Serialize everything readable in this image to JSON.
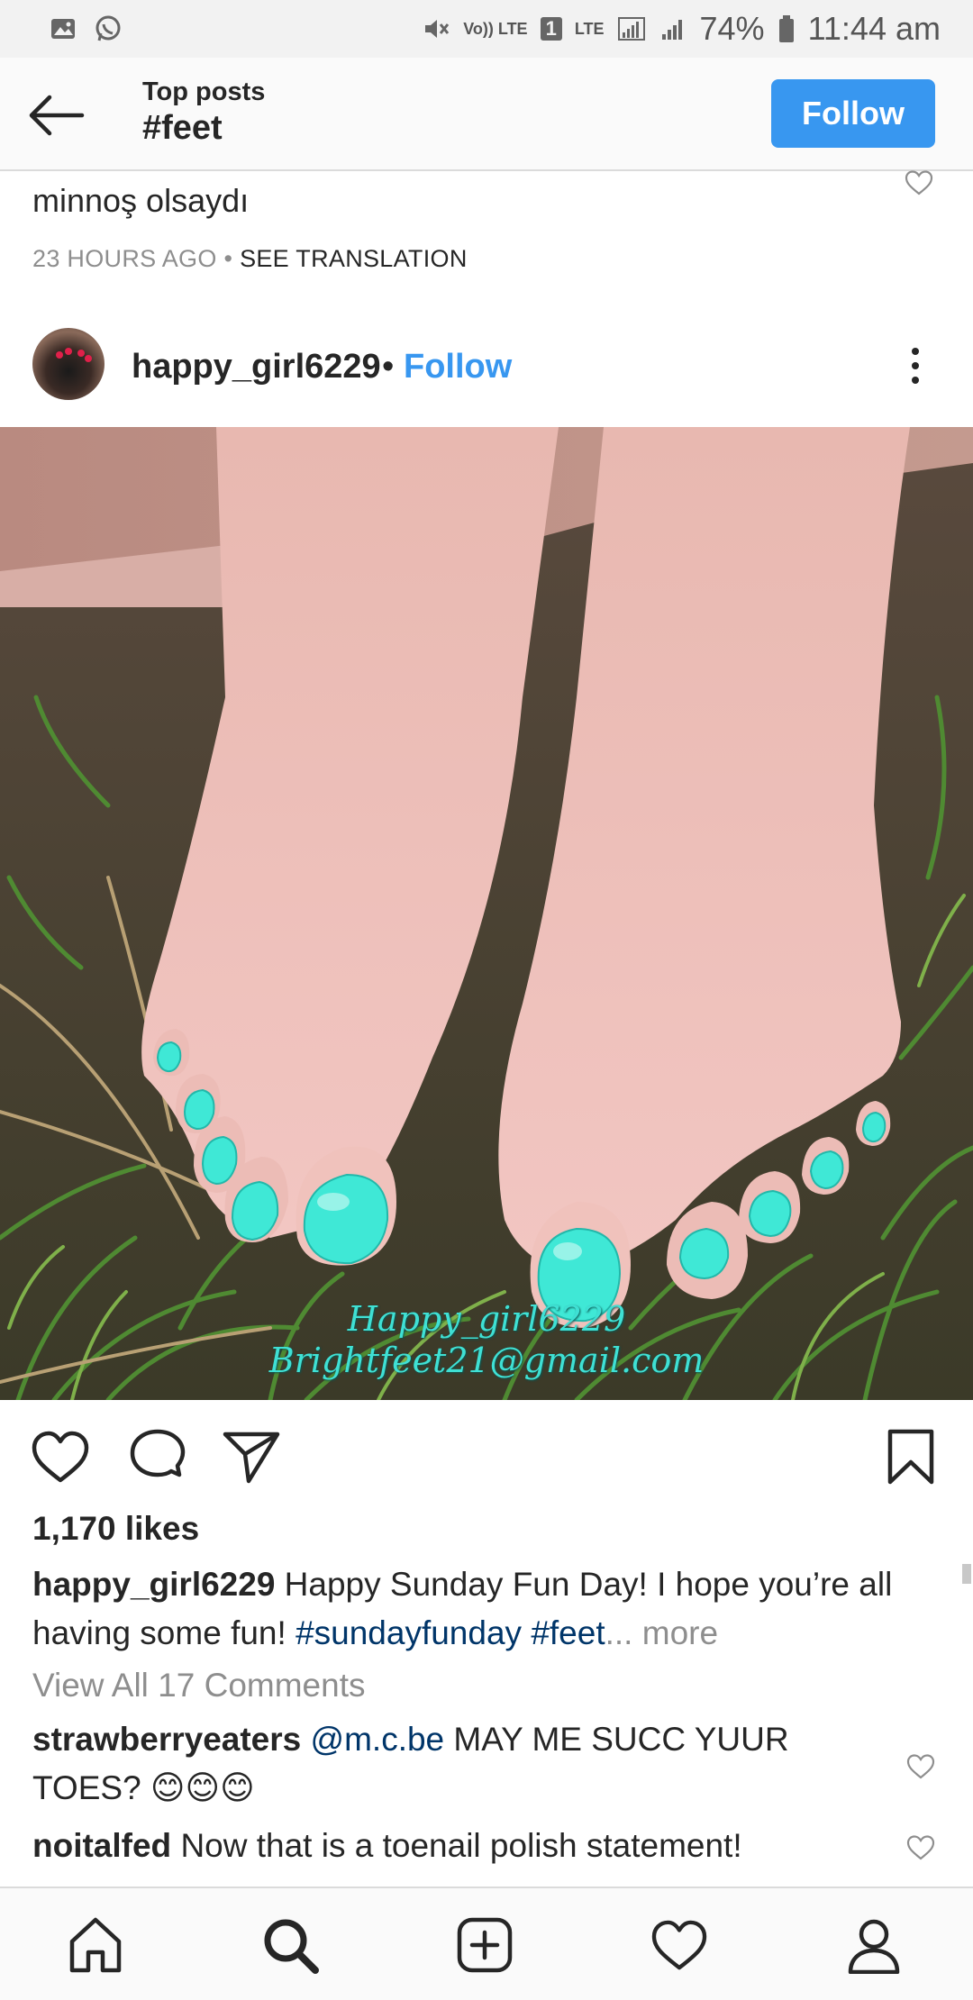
{
  "status_bar": {
    "battery": "74%",
    "time": "11:44 am",
    "volte": "Vo)) LTE",
    "sim": "1",
    "lte": "LTE"
  },
  "header": {
    "subtitle": "Top posts",
    "hashtag": "#feet",
    "follow_label": "Follow"
  },
  "previous_post": {
    "caption_tail": "minnoş olsaydı",
    "time_ago": "23 HOURS AGO",
    "separator": "•",
    "see_translation": "SEE TRANSLATION"
  },
  "post": {
    "username": "happy_girl6229",
    "separator": "•",
    "follow_label": "Follow",
    "watermark_line1": "Happy_girl6229",
    "watermark_line2": "Brightfeet21@gmail.com",
    "likes": "1,170 likes",
    "caption_user": "happy_girl6229",
    "caption_text": " Happy Sunday Fun Day! I hope you’re all having some fun! ",
    "caption_tag1": "#sundayfunday",
    "caption_tag2": " #feet",
    "caption_ellipsis": "...",
    "caption_more": " more",
    "view_all": "View All 17 Comments",
    "comments": [
      {
        "user": "strawberryeaters",
        "mention": " @m.c.be",
        "text": " MAY ME SUCC YUUR TOES? 😊😊😊"
      },
      {
        "user": "noitalfed",
        "mention": "",
        "text": " Now that is a toenail polish statement!"
      }
    ]
  },
  "icons": {
    "back": "arrow-left-icon",
    "heart": "heart-icon",
    "comment": "comment-icon",
    "share": "send-icon",
    "bookmark": "bookmark-icon",
    "home": "home-icon",
    "search": "search-icon",
    "add": "add-post-icon",
    "activity": "heart-icon",
    "profile": "profile-icon"
  },
  "colors": {
    "accent": "#3897f0",
    "hashtag": "#003569",
    "muted": "#8e8e8e",
    "nail_polish": "#3fe8d6"
  }
}
